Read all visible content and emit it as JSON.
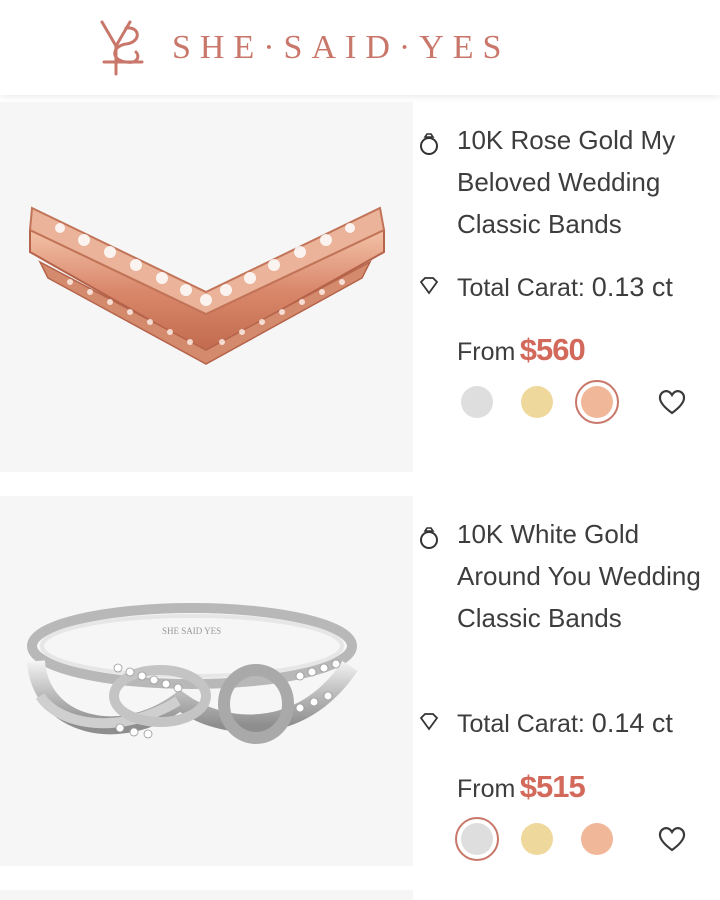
{
  "header": {
    "brand_name": "SHE·SAID·YES",
    "colors": {
      "brand": "#c8776a",
      "price": "#d2695b"
    }
  },
  "products": [
    {
      "title": "10K Rose Gold My Beloved Wedding Classic Bands",
      "carat_label": "Total Carat:",
      "carat_value": "0.13 ct",
      "from_label": "From",
      "price": "$560",
      "metal_options": [
        "white-gold",
        "yellow-gold",
        "rose-gold"
      ],
      "selected_metal": "rose-gold"
    },
    {
      "title": "10K White Gold Around You Wedding Classic Bands",
      "carat_label": "Total Carat:",
      "carat_value": "0.14 ct",
      "from_label": "From",
      "price": "$515",
      "metal_options": [
        "white-gold",
        "yellow-gold",
        "rose-gold"
      ],
      "selected_metal": "white-gold"
    }
  ],
  "swatch_colors": {
    "white-gold": "#dedede",
    "yellow-gold": "#efd89c",
    "rose-gold": "#f1b799"
  },
  "icons": [
    "ring-icon",
    "diamond-icon",
    "heart-icon",
    "logo-icon"
  ]
}
